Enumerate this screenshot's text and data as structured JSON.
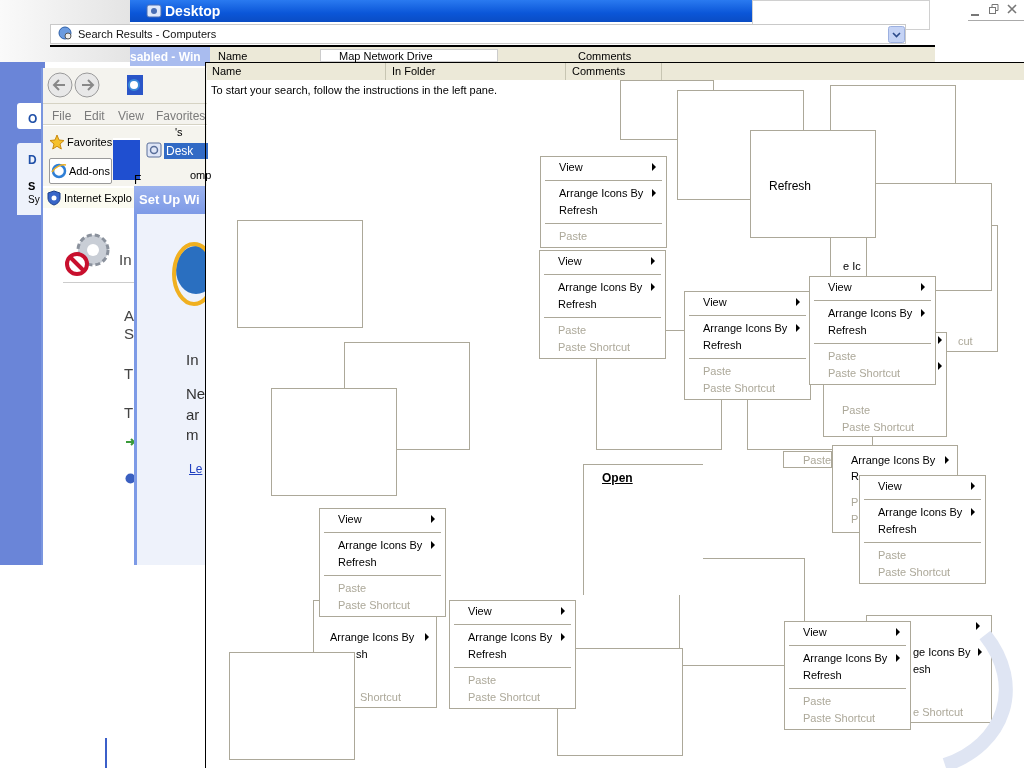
{
  "desktop_window": {
    "title": "Desktop"
  },
  "address_bar": {
    "text": "Search Results - Computers"
  },
  "back_window": {
    "title": "sabled - Win",
    "columns": [
      "Name",
      "Map Network Drive",
      "Comments"
    ]
  },
  "search_results": {
    "columns": [
      "Name",
      "In Folder",
      "Comments"
    ],
    "message": "To start your search, follow the instructions in the left pane."
  },
  "task_pane": {
    "texts": [
      "O",
      "D",
      "S",
      "Sy"
    ]
  },
  "ie_window": {
    "menu": [
      "File",
      "Edit",
      "View",
      "Favorites"
    ],
    "links": [
      {
        "kind": "star",
        "text": "Favorites",
        "selected": false
      },
      {
        "kind": "browser",
        "text": "Add-ons",
        "selected": true
      },
      {
        "kind": "shield",
        "text": "Internet Explo",
        "selected": false
      }
    ],
    "texts": [
      "In",
      "A",
      "S",
      "T",
      "T"
    ]
  },
  "desktop_item": {
    "label": "Desk",
    "selected": true
  },
  "stray_texts": [
    "'s",
    "omp",
    "F"
  ],
  "setup_dialog": {
    "title": "Set Up Wi",
    "texts": [
      "In",
      "Ne",
      "ar",
      "m"
    ],
    "link": "Le"
  },
  "blank_menu": {
    "text": "Refresh"
  },
  "open_label": "Open",
  "context_menus": [
    {
      "items": [
        {
          "kind": "item",
          "text": "View",
          "submenu": true,
          "disabled": false
        },
        {
          "kind": "separator"
        },
        {
          "kind": "item",
          "text": "Arrange Icons By",
          "submenu": true,
          "disabled": false
        },
        {
          "kind": "item",
          "text": "Refresh",
          "submenu": false,
          "disabled": false
        },
        {
          "kind": "separator"
        },
        {
          "kind": "item",
          "text": "Paste",
          "submenu": false,
          "disabled": true
        }
      ]
    },
    {
      "items": [
        {
          "kind": "item",
          "text": "View",
          "submenu": true,
          "disabled": false
        },
        {
          "kind": "separator"
        },
        {
          "kind": "item",
          "text": "Arrange Icons By",
          "submenu": true,
          "disabled": false
        },
        {
          "kind": "item",
          "text": "Refresh",
          "submenu": false,
          "disabled": false
        },
        {
          "kind": "separator"
        },
        {
          "kind": "item",
          "text": "Paste",
          "submenu": false,
          "disabled": true
        },
        {
          "kind": "item",
          "text": "Paste Shortcut",
          "submenu": false,
          "disabled": true
        }
      ]
    },
    {
      "items": [
        {
          "kind": "item",
          "text": "View",
          "submenu": true,
          "disabled": false
        },
        {
          "kind": "separator"
        },
        {
          "kind": "item",
          "text": "Arrange Icons By",
          "submenu": true,
          "disabled": false
        },
        {
          "kind": "item",
          "text": "Refresh",
          "submenu": false,
          "disabled": false
        },
        {
          "kind": "separator"
        },
        {
          "kind": "item",
          "text": "Paste",
          "submenu": false,
          "disabled": true
        },
        {
          "kind": "item",
          "text": "Paste Shortcut",
          "submenu": false,
          "disabled": true
        }
      ]
    },
    {
      "items": [
        {
          "kind": "item",
          "text": "View",
          "submenu": true,
          "disabled": false
        },
        {
          "kind": "separator"
        },
        {
          "kind": "item",
          "text": "Arrange Icons By",
          "submenu": true,
          "disabled": false
        },
        {
          "kind": "item",
          "text": "Refresh",
          "submenu": false,
          "disabled": false
        },
        {
          "kind": "separator"
        },
        {
          "kind": "item",
          "text": "Paste",
          "submenu": false,
          "disabled": true
        },
        {
          "kind": "item",
          "text": "Paste Shortcut",
          "submenu": false,
          "disabled": true
        }
      ]
    },
    {
      "items": [
        {
          "kind": "item",
          "text": "View",
          "submenu": true,
          "disabled": false
        },
        {
          "kind": "separator"
        },
        {
          "kind": "item",
          "text": "Arrange Icons By",
          "submenu": true,
          "disabled": false
        },
        {
          "kind": "item",
          "text": "Refresh",
          "submenu": false,
          "disabled": false
        },
        {
          "kind": "separator"
        },
        {
          "kind": "item",
          "text": "Paste",
          "submenu": false,
          "disabled": true
        },
        {
          "kind": "item",
          "text": "Paste Shortcut",
          "submenu": false,
          "disabled": true
        }
      ]
    },
    {
      "items": [
        {
          "kind": "item",
          "text": "View",
          "submenu": true,
          "disabled": false
        },
        {
          "kind": "separator"
        },
        {
          "kind": "item",
          "text": "Arrange Icons By",
          "submenu": true,
          "disabled": false
        },
        {
          "kind": "item",
          "text": "Refresh",
          "submenu": false,
          "disabled": false
        },
        {
          "kind": "separator"
        },
        {
          "kind": "item",
          "text": "Paste",
          "submenu": false,
          "disabled": true
        },
        {
          "kind": "item",
          "text": "Paste Shortcut",
          "submenu": false,
          "disabled": true
        }
      ]
    },
    {
      "items": [
        {
          "kind": "item",
          "text": "View",
          "submenu": true,
          "disabled": false
        },
        {
          "kind": "separator"
        },
        {
          "kind": "item",
          "text": "Arrange Icons By",
          "submenu": true,
          "disabled": false
        },
        {
          "kind": "item",
          "text": "Refresh",
          "submenu": false,
          "disabled": false
        },
        {
          "kind": "separator"
        },
        {
          "kind": "item",
          "text": "Paste",
          "submenu": false,
          "disabled": true
        },
        {
          "kind": "item",
          "text": "Paste Shortcut",
          "submenu": false,
          "disabled": true
        }
      ]
    },
    {
      "items": [
        {
          "kind": "item",
          "text": "View",
          "submenu": true,
          "disabled": false
        },
        {
          "kind": "separator"
        },
        {
          "kind": "item",
          "text": "Arrange Icons By",
          "submenu": true,
          "disabled": false
        },
        {
          "kind": "item",
          "text": "Refresh",
          "submenu": false,
          "disabled": false
        },
        {
          "kind": "separator"
        },
        {
          "kind": "item",
          "text": "Paste",
          "submenu": false,
          "disabled": true
        },
        {
          "kind": "item",
          "text": "Paste Shortcut",
          "submenu": false,
          "disabled": true
        }
      ]
    }
  ],
  "menu_fragments": [
    {
      "kind": "text",
      "text": "Arrange Icons By",
      "submenu": true,
      "disabled": false
    },
    {
      "kind": "text",
      "text": "sh",
      "disabled": false
    },
    {
      "kind": "text",
      "text": "Shortcut",
      "disabled": true
    },
    {
      "kind": "arrow"
    },
    {
      "kind": "text",
      "text": "ge Icons By",
      "submenu": true,
      "disabled": false
    },
    {
      "kind": "text",
      "text": "esh",
      "disabled": false
    },
    {
      "kind": "text",
      "text": "e Shortcut",
      "disabled": true
    },
    {
      "kind": "arrow"
    },
    {
      "kind": "arrow"
    },
    {
      "kind": "text",
      "text": "Paste",
      "disabled": true
    },
    {
      "kind": "text",
      "text": "Paste Shortcut",
      "disabled": true
    },
    {
      "kind": "text",
      "text": "Arrange Icons By",
      "submenu": true,
      "disabled": false
    },
    {
      "kind": "text",
      "text": "R",
      "disabled": false
    },
    {
      "kind": "text",
      "text": "P",
      "disabled": true
    },
    {
      "kind": "text",
      "text": "P",
      "disabled": true
    },
    {
      "kind": "text",
      "text": "Paste",
      "disabled": true
    },
    {
      "kind": "text",
      "text": "e Ic",
      "disabled": false
    },
    {
      "kind": "text",
      "text": "cut",
      "disabled": true
    }
  ]
}
